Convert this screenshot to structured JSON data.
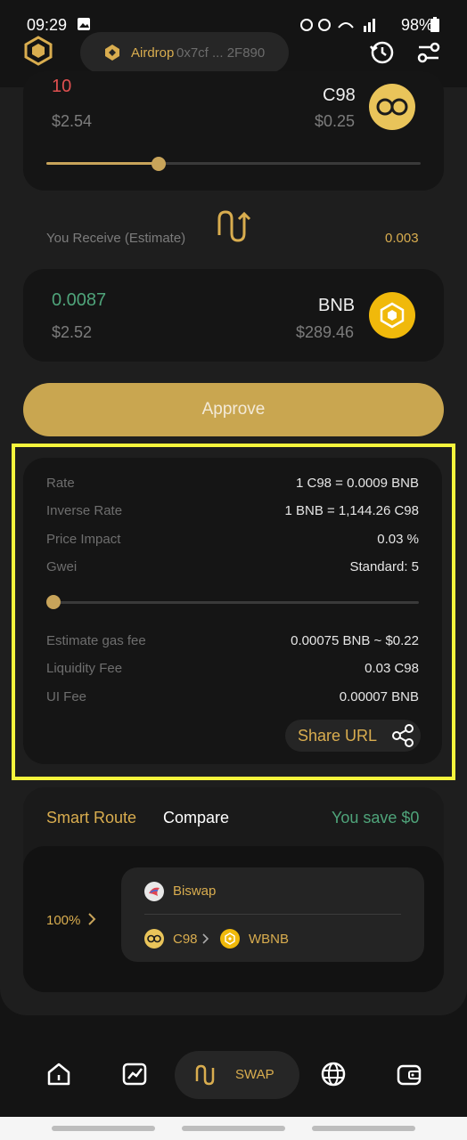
{
  "status_bar": {
    "time": "09:29",
    "right": "98%"
  },
  "header": {
    "wallet_name": "Airdrop",
    "wallet_address": "0x7cf ... 2F890"
  },
  "pay": {
    "amount": "10",
    "amount_usd": "$2.54",
    "token": "C98",
    "token_price": "$0.25",
    "slider_percent": 30
  },
  "receive": {
    "label": "You Receive (Estimate)",
    "value": "0.003",
    "amount": "0.0087",
    "amount_usd": "$2.52",
    "token": "BNB",
    "token_price": "$289.46"
  },
  "approve_label": "Approve",
  "details": {
    "rows_top": [
      {
        "label": "Rate",
        "value": "1 C98 = 0.0009 BNB"
      },
      {
        "label": "Inverse Rate",
        "value": "1 BNB = 1,144.26 C98"
      },
      {
        "label": "Price Impact",
        "value": "0.03 %"
      },
      {
        "label": "Gwei",
        "value": "Standard: 5"
      }
    ],
    "gwei_slider_percent": 0,
    "rows_bottom": [
      {
        "label": "Estimate gas fee",
        "value": "0.00075 BNB ~ $0.22"
      },
      {
        "label": "Liquidity Fee",
        "value": "0.03 C98"
      },
      {
        "label": "UI Fee",
        "value": "0.00007 BNB"
      }
    ],
    "share_label": "Share URL"
  },
  "route": {
    "tab_smart": "Smart Route",
    "tab_compare": "Compare",
    "saving": "You save $0",
    "percent": "100%",
    "dex": "Biswap",
    "from_token": "C98",
    "to_token": "WBNB"
  },
  "nav": {
    "swap_label": "SWAP"
  },
  "colors": {
    "accent": "#d9ad4f",
    "green": "#4fa47a",
    "highlight": "#f5f53c"
  }
}
